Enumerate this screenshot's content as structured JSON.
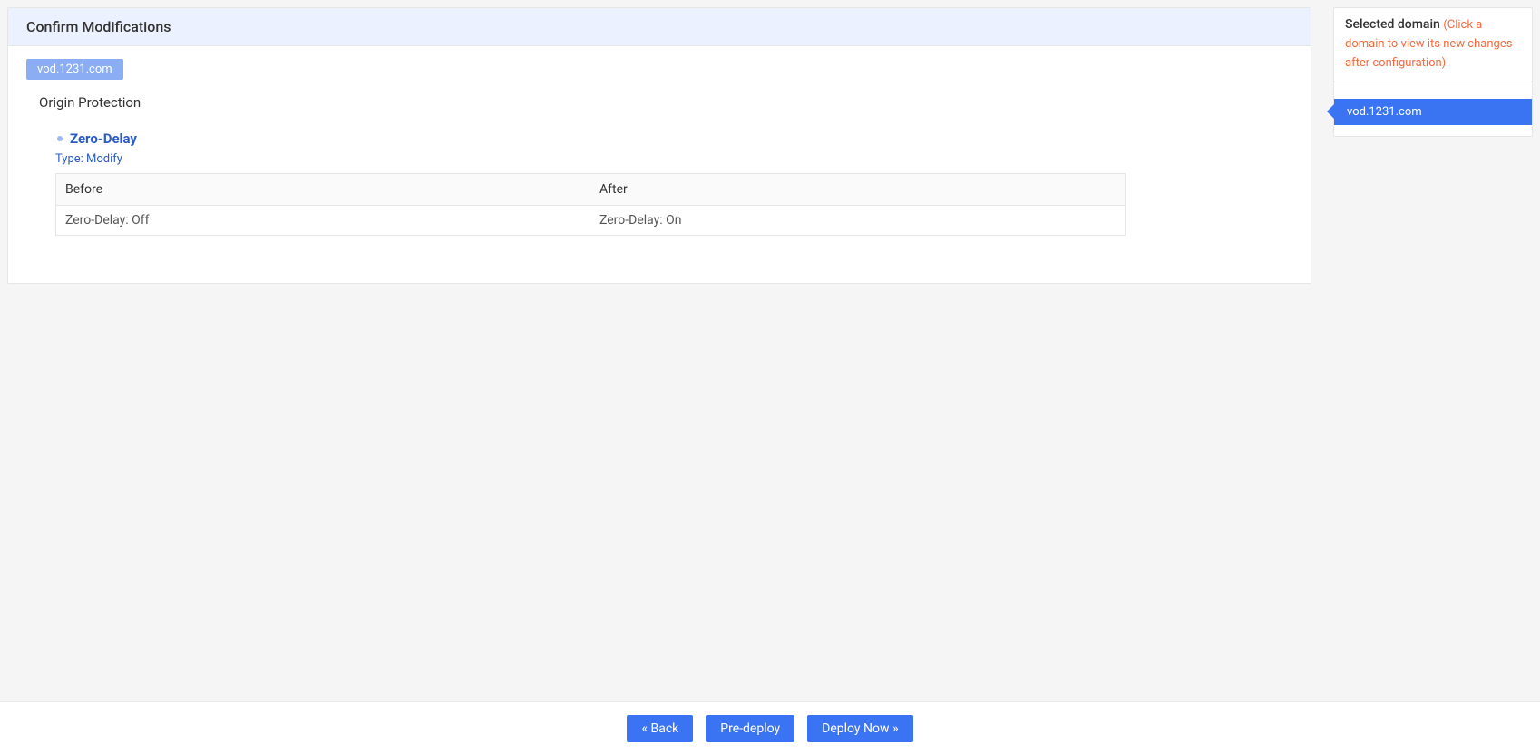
{
  "header": {
    "title": "Confirm Modifications"
  },
  "domain_tag": "vod.1231.com",
  "section_title": "Origin Protection",
  "change": {
    "name": "Zero-Delay",
    "type_label": "Type: Modify",
    "before_header": "Before",
    "after_header": "After",
    "before_value": "Zero-Delay: Off",
    "after_value": "Zero-Delay: On"
  },
  "sidebar": {
    "title": "Selected domain",
    "hint": "(Click a domain to view its new changes after configuration)",
    "items": [
      {
        "label": "vod.1231.com"
      }
    ]
  },
  "footer": {
    "back": "« Back",
    "predeploy": "Pre-deploy",
    "deploy": "Deploy Now »"
  }
}
